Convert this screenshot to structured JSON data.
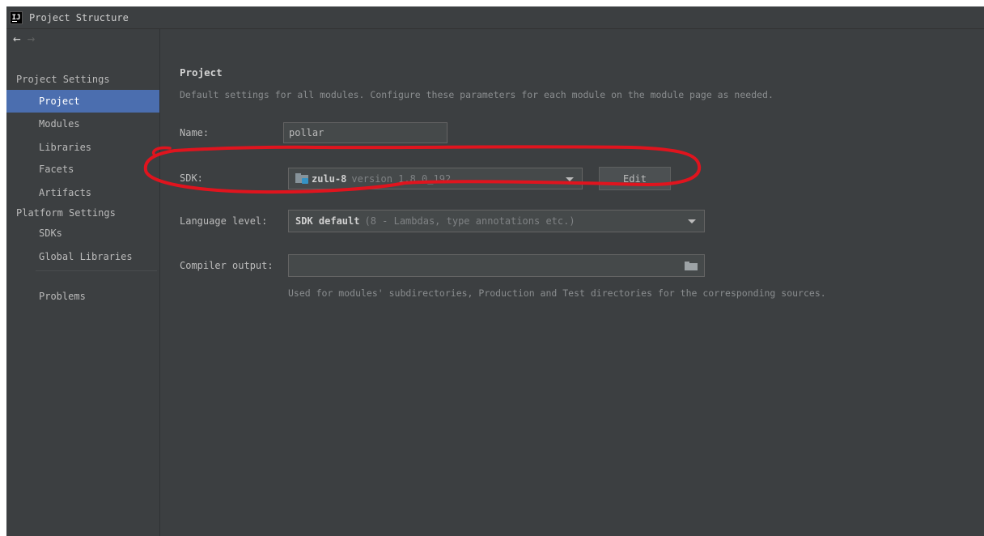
{
  "window": {
    "title": "Project Structure",
    "app_icon_text": "IJ"
  },
  "nav": {
    "back_icon": "arrow-left-icon",
    "forward_icon": "arrow-right-icon",
    "back": "←",
    "forward": "→"
  },
  "sidebar": {
    "project_settings_header": "Project Settings",
    "project_items": [
      {
        "label": "Project",
        "selected": true
      },
      {
        "label": "Modules"
      },
      {
        "label": "Libraries"
      },
      {
        "label": "Facets"
      },
      {
        "label": "Artifacts"
      }
    ],
    "platform_settings_header": "Platform Settings",
    "platform_items": [
      {
        "label": "SDKs"
      },
      {
        "label": "Global Libraries"
      }
    ],
    "problems_label": "Problems"
  },
  "main": {
    "title": "Project",
    "description": "Default settings for all modules. Configure these parameters for each module on the module page as needed.",
    "name": {
      "label": "Name:",
      "value": "pollar"
    },
    "sdk": {
      "label": "SDK:",
      "name": "zulu-8",
      "version": "version 1.8.0_192",
      "icon": "sdk-folder-icon",
      "edit_label": "Edit"
    },
    "language_level": {
      "label": "Language level:",
      "value": "SDK default",
      "detail": "(8 - Lambdas, type annotations etc.)"
    },
    "compiler_output": {
      "label": "Compiler output:",
      "value": "",
      "browse_icon": "folder-open-icon",
      "hint": "Used for modules' subdirectories, Production and Test directories for the corresponding sources."
    }
  },
  "colors": {
    "background": "#3c3f41",
    "selection": "#4b6eaf",
    "input_background": "#45494a",
    "text": "#bbbbbb",
    "annotation": "#e0141e"
  }
}
